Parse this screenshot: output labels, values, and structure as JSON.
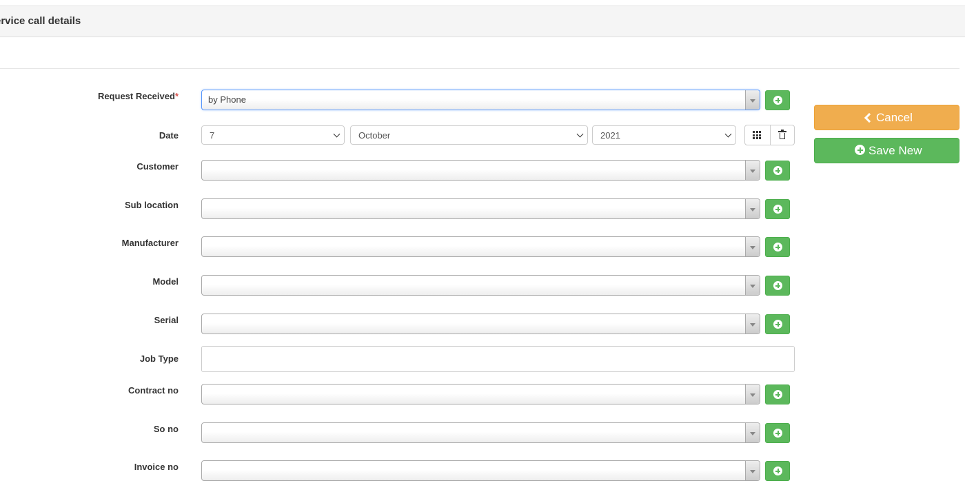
{
  "panel": {
    "title": "ervice call details"
  },
  "form": {
    "request_received": {
      "label": "Request Received",
      "required_mark": "*",
      "value": "by Phone"
    },
    "date": {
      "label": "Date",
      "day": "7",
      "month": "October",
      "year": "2021"
    },
    "customer": {
      "label": "Customer",
      "value": ""
    },
    "sub_location": {
      "label": "Sub location",
      "value": ""
    },
    "manufacturer": {
      "label": "Manufacturer",
      "value": ""
    },
    "model": {
      "label": "Model",
      "value": ""
    },
    "serial": {
      "label": "Serial",
      "value": ""
    },
    "job_type": {
      "label": "Job Type",
      "value": ""
    },
    "contract_no": {
      "label": "Contract no",
      "value": ""
    },
    "so_no": {
      "label": "So no",
      "value": ""
    },
    "invoice_no": {
      "label": "Invoice no",
      "value": ""
    }
  },
  "actions": {
    "cancel_label": "Cancel",
    "save_new_label": "Save New"
  },
  "icons": {
    "add": "plus-circle-icon",
    "calendar": "grid-icon",
    "clear_date": "trash-icon",
    "cancel": "chevron-left-icon",
    "save": "plus-circle-icon"
  },
  "colors": {
    "success": "#5cb85c",
    "warning": "#f0ad4e",
    "focus": "#5897fb",
    "required": "#d9534f"
  }
}
